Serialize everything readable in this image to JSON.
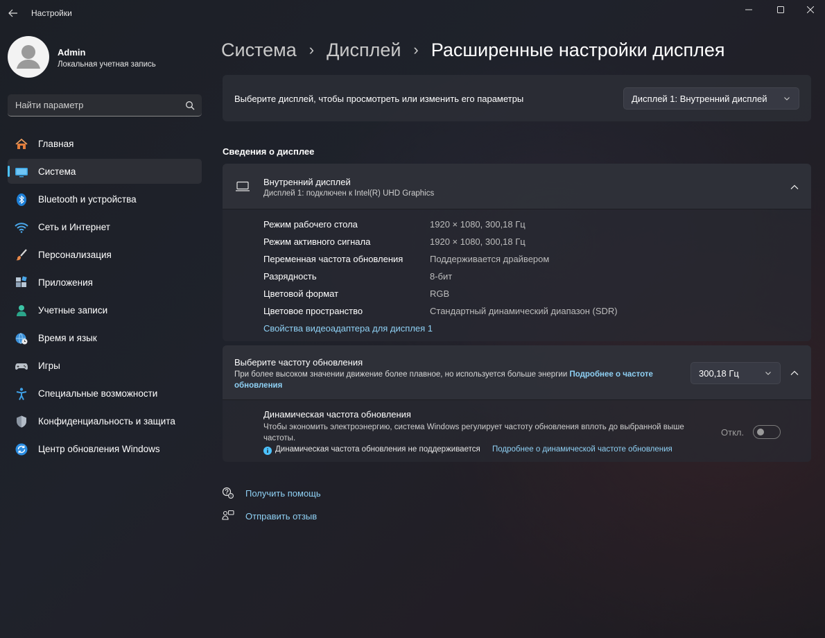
{
  "app": {
    "title": "Настройки"
  },
  "icons": {
    "back": "arrow-left-icon",
    "minimize": "minimize-icon",
    "maximize": "maximize-icon",
    "close": "close-icon",
    "search": "search-icon"
  },
  "colors": {
    "accent": "#4cc2ff",
    "link": "#8fd1f5"
  },
  "profile": {
    "name": "Admin",
    "subtitle": "Локальная учетная запись"
  },
  "search": {
    "placeholder": "Найти параметр"
  },
  "sidebar": {
    "items": [
      {
        "label": "Главная",
        "icon": "home-icon",
        "active": false
      },
      {
        "label": "Система",
        "icon": "system-display-icon",
        "active": true
      },
      {
        "label": "Bluetooth и устройства",
        "icon": "bluetooth-icon",
        "active": false
      },
      {
        "label": "Сеть и Интернет",
        "icon": "wifi-icon",
        "active": false
      },
      {
        "label": "Персонализация",
        "icon": "brush-icon",
        "active": false
      },
      {
        "label": "Приложения",
        "icon": "apps-icon",
        "active": false
      },
      {
        "label": "Учетные записи",
        "icon": "accounts-icon",
        "active": false
      },
      {
        "label": "Время и язык",
        "icon": "globe-clock-icon",
        "active": false
      },
      {
        "label": "Игры",
        "icon": "gamepad-icon",
        "active": false
      },
      {
        "label": "Специальные возможности",
        "icon": "accessibility-icon",
        "active": false
      },
      {
        "label": "Конфиденциальность и защита",
        "icon": "shield-icon",
        "active": false
      },
      {
        "label": "Центр обновления Windows",
        "icon": "update-icon",
        "active": false
      }
    ]
  },
  "breadcrumb": {
    "items": [
      "Система",
      "Дисплей"
    ],
    "current": "Расширенные настройки дисплея",
    "separator": "›"
  },
  "display_select": {
    "label": "Выберите дисплей, чтобы просмотреть или изменить его параметры",
    "value": "Дисплей 1: Внутренний дисплей"
  },
  "display_info": {
    "section_title": "Сведения о дисплее",
    "title": "Внутренний дисплей",
    "subtitle": "Дисплей 1: подключен к Intel(R) UHD Graphics",
    "properties": [
      {
        "key": "Режим рабочего стола",
        "value": "1920 × 1080, 300,18 Гц"
      },
      {
        "key": "Режим активного сигнала",
        "value": "1920 × 1080, 300,18 Гц"
      },
      {
        "key": "Переменная частота обновления",
        "value": "Поддерживается драйвером"
      },
      {
        "key": "Разрядность",
        "value": "8-бит"
      },
      {
        "key": "Цветовой формат",
        "value": "RGB"
      },
      {
        "key": "Цветовое пространство",
        "value": "Стандартный динамический диапазон (SDR)"
      }
    ],
    "adapter_link": "Свойства видеоадаптера для дисплея 1"
  },
  "refresh_rate": {
    "title": "Выберите частоту обновления",
    "description": "При более высоком значении движение более плавное, но используется больше энергии",
    "link": "Подробнее о частоте обновления",
    "value": "300,18 Гц"
  },
  "dynamic_refresh": {
    "title": "Динамическая частота обновления",
    "description": "Чтобы экономить электроэнергию, система Windows регулирует частоту обновления вплоть до выбранной выше частоты.",
    "info": "Динамическая частота обновления не поддерживается",
    "link": "Подробнее о динамической частоте обновления",
    "toggle_label": "Откл.",
    "toggle_on": false
  },
  "footer": {
    "help": "Получить помощь",
    "feedback": "Отправить отзыв"
  }
}
